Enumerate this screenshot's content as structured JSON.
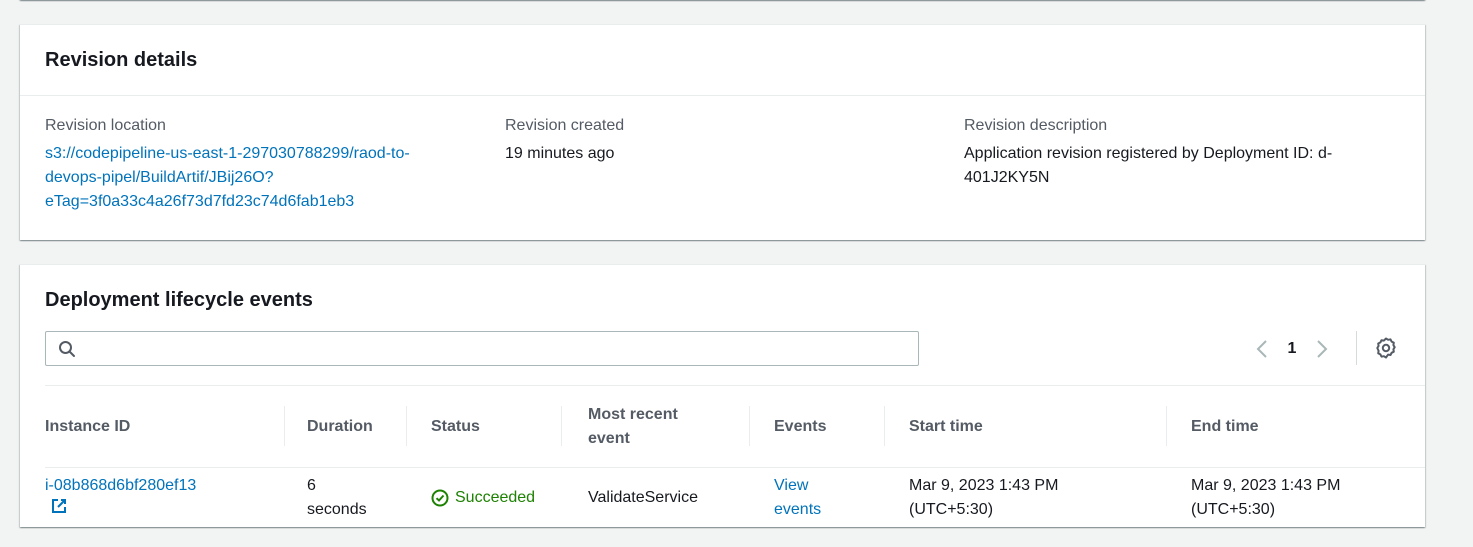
{
  "revision": {
    "title": "Revision details",
    "location_label": "Revision location",
    "location_line1": "s3://codepipeline-us-east-1-297030788299/raod-to-",
    "location_line2": "devops-pipel/BuildArtif/JBij26O?",
    "location_line3": "eTag=3f0a33c4a26f73d7fd23c74d6fab1eb3",
    "created_label": "Revision created",
    "created_value": "19 minutes ago",
    "description_label": "Revision description",
    "description_line1": "Application revision registered by Deployment ID: d-",
    "description_line2": "401J2KY5N"
  },
  "lifecycle": {
    "title": "Deployment lifecycle events",
    "search_placeholder": "",
    "page_number": "1",
    "columns": {
      "instance_id": "Instance ID",
      "duration": "Duration",
      "status": "Status",
      "recent_event_line1": "Most recent",
      "recent_event_line2": "event",
      "events": "Events",
      "start_time": "Start time",
      "end_time": "End time"
    },
    "rows": [
      {
        "instance_id": "i-08b868d6bf280ef13",
        "duration_line1": "6",
        "duration_line2": "seconds",
        "status": "Succeeded",
        "recent_event": "ValidateService",
        "events_line1": "View",
        "events_line2": "events",
        "start_line1": "Mar 9, 2023 1:43 PM",
        "start_line2": "(UTC+5:30)",
        "end_line1": "Mar 9, 2023 1:43 PM",
        "end_line2": "(UTC+5:30)"
      }
    ]
  },
  "icons": {
    "search": "search-icon",
    "prev": "chevron-left-icon",
    "next": "chevron-right-icon",
    "settings": "gear-icon",
    "external": "external-link-icon",
    "status": "check-circle-icon"
  },
  "colors": {
    "link": "#0073bb",
    "success": "#1d8102",
    "background": "#f2f3f3"
  }
}
